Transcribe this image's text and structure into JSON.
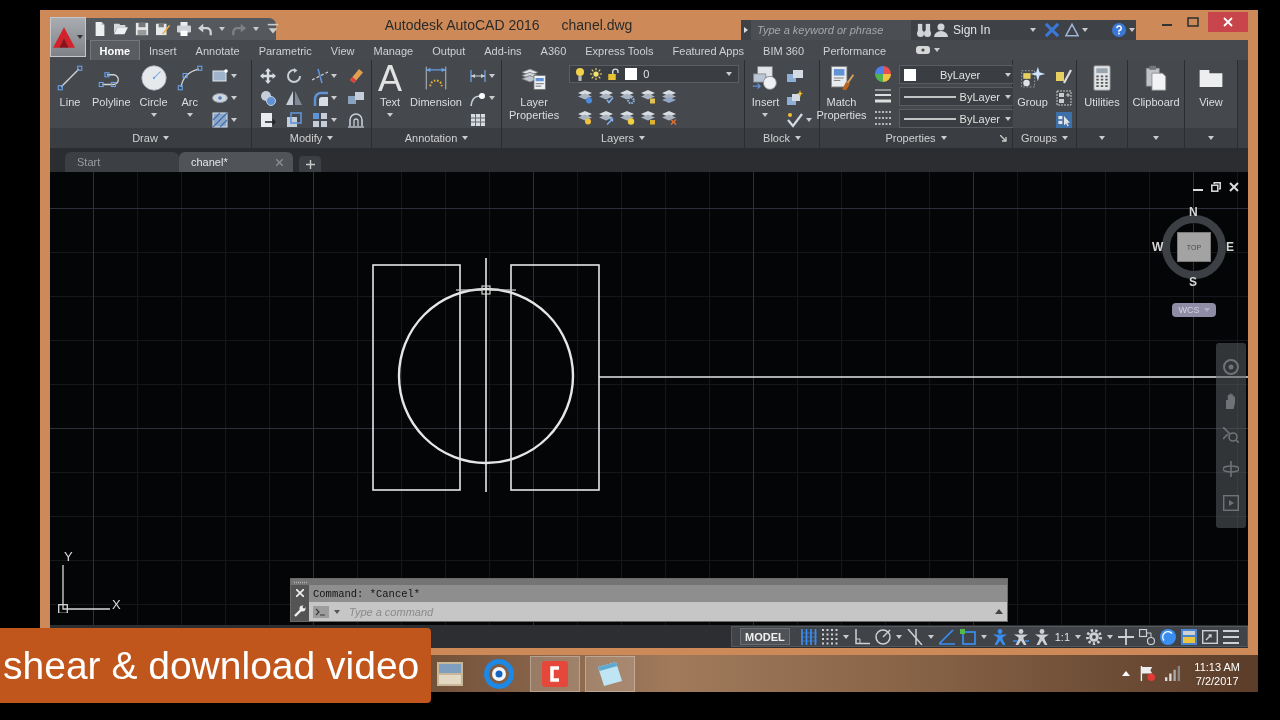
{
  "window": {
    "app_title": "Autodesk AutoCAD 2016",
    "file_name": "chanel.dwg"
  },
  "quick_access": {
    "redo_disabled": true
  },
  "search": {
    "placeholder": "Type a keyword or phrase"
  },
  "account": {
    "label": "Sign In"
  },
  "ribbon_tabs": [
    {
      "label": "Home",
      "selected": true
    },
    {
      "label": "Insert",
      "selected": false
    },
    {
      "label": "Annotate",
      "selected": false
    },
    {
      "label": "Parametric",
      "selected": false
    },
    {
      "label": "View",
      "selected": false
    },
    {
      "label": "Manage",
      "selected": false
    },
    {
      "label": "Output",
      "selected": false
    },
    {
      "label": "Add-ins",
      "selected": false
    },
    {
      "label": "A360",
      "selected": false
    },
    {
      "label": "Express Tools",
      "selected": false
    },
    {
      "label": "Featured Apps",
      "selected": false
    },
    {
      "label": "BIM 360",
      "selected": false
    },
    {
      "label": "Performance",
      "selected": false
    }
  ],
  "ribbon_panels": [
    {
      "kind": "draw",
      "title": "Draw",
      "tools": [
        {
          "label": "Line",
          "menu": false
        },
        {
          "label": "Polyline",
          "menu": false
        },
        {
          "label": "Circle",
          "menu": true
        },
        {
          "label": "Arc",
          "menu": true
        }
      ]
    },
    {
      "kind": "modify",
      "title": "Modify"
    },
    {
      "kind": "annotation",
      "title": "Annotation",
      "tools": [
        {
          "label": "Text",
          "glyph": "A",
          "menu": true
        },
        {
          "label": "Dimension",
          "menu": false
        }
      ]
    },
    {
      "kind": "layers",
      "title": "Layers",
      "tools": [
        {
          "label": "Layer Properties",
          "menu": false
        }
      ],
      "current_layer": "0"
    },
    {
      "kind": "block",
      "title": "Block",
      "tools": [
        {
          "label": "Insert",
          "menu": true
        }
      ]
    },
    {
      "kind": "properties",
      "title": "Properties",
      "tools": [
        {
          "label": "Match Properties",
          "menu": false
        }
      ],
      "dropdowns": [
        {
          "kind": "color",
          "value": "ByLayer"
        },
        {
          "kind": "lineweight",
          "value": "ByLayer"
        },
        {
          "kind": "linetype",
          "value": "ByLayer"
        }
      ]
    },
    {
      "kind": "groups",
      "title": "Groups",
      "tools": [
        {
          "label": "Group",
          "menu": false
        }
      ],
      "group_selection_on": true
    },
    {
      "kind": "utilities",
      "tools": [
        {
          "label": "Utilities",
          "menu": true
        }
      ]
    },
    {
      "kind": "clipboard",
      "tools": [
        {
          "label": "Clipboard",
          "menu": true
        }
      ]
    },
    {
      "kind": "view",
      "tools": [
        {
          "label": "View",
          "menu": true
        }
      ]
    }
  ],
  "file_tabs": [
    {
      "label": "Start",
      "selected": false,
      "closable": false
    },
    {
      "label": "chanel*",
      "selected": true,
      "closable": true
    }
  ],
  "viewcube": {
    "north": "N",
    "west": "W",
    "east": "E",
    "south": "S",
    "face": "TOP",
    "coordinate_system": "WCS"
  },
  "ucs_icon": {
    "y_label": "Y",
    "x_label": "X"
  },
  "command_line": {
    "history": "Command: *Cancel*",
    "placeholder": "Type a command"
  },
  "status_bar": [
    {
      "kind": "space",
      "label": "MODEL"
    },
    {
      "kind": "grid",
      "on": true,
      "menu": false
    },
    {
      "kind": "snap",
      "on": false,
      "menu": true
    },
    {
      "kind": "ortho",
      "on": false,
      "menu": false
    },
    {
      "kind": "polar",
      "on": false,
      "menu": true
    },
    {
      "kind": "isodraft",
      "on": false,
      "menu": true
    },
    {
      "kind": "track",
      "on": true,
      "menu": false
    },
    {
      "kind": "osnap",
      "on": true,
      "menu": true
    },
    {
      "kind": "annovis",
      "on": true,
      "menu": false
    },
    {
      "kind": "autoscale",
      "on": false,
      "menu": false
    },
    {
      "kind": "scale",
      "label": "1:1",
      "menu": true
    },
    {
      "kind": "workspace",
      "menu": true
    },
    {
      "kind": "monitor",
      "menu": false
    },
    {
      "kind": "isolate",
      "menu": false
    },
    {
      "kind": "hwaccel",
      "on": true,
      "menu": false
    },
    {
      "kind": "cleanscreen",
      "menu": false
    },
    {
      "kind": "fullscreen",
      "menu": false
    },
    {
      "kind": "customize",
      "menu": false
    }
  ],
  "taskbar": {
    "time": "11:13 AM",
    "date": "7/2/2017"
  },
  "overlay_caption": "shear & download video"
}
